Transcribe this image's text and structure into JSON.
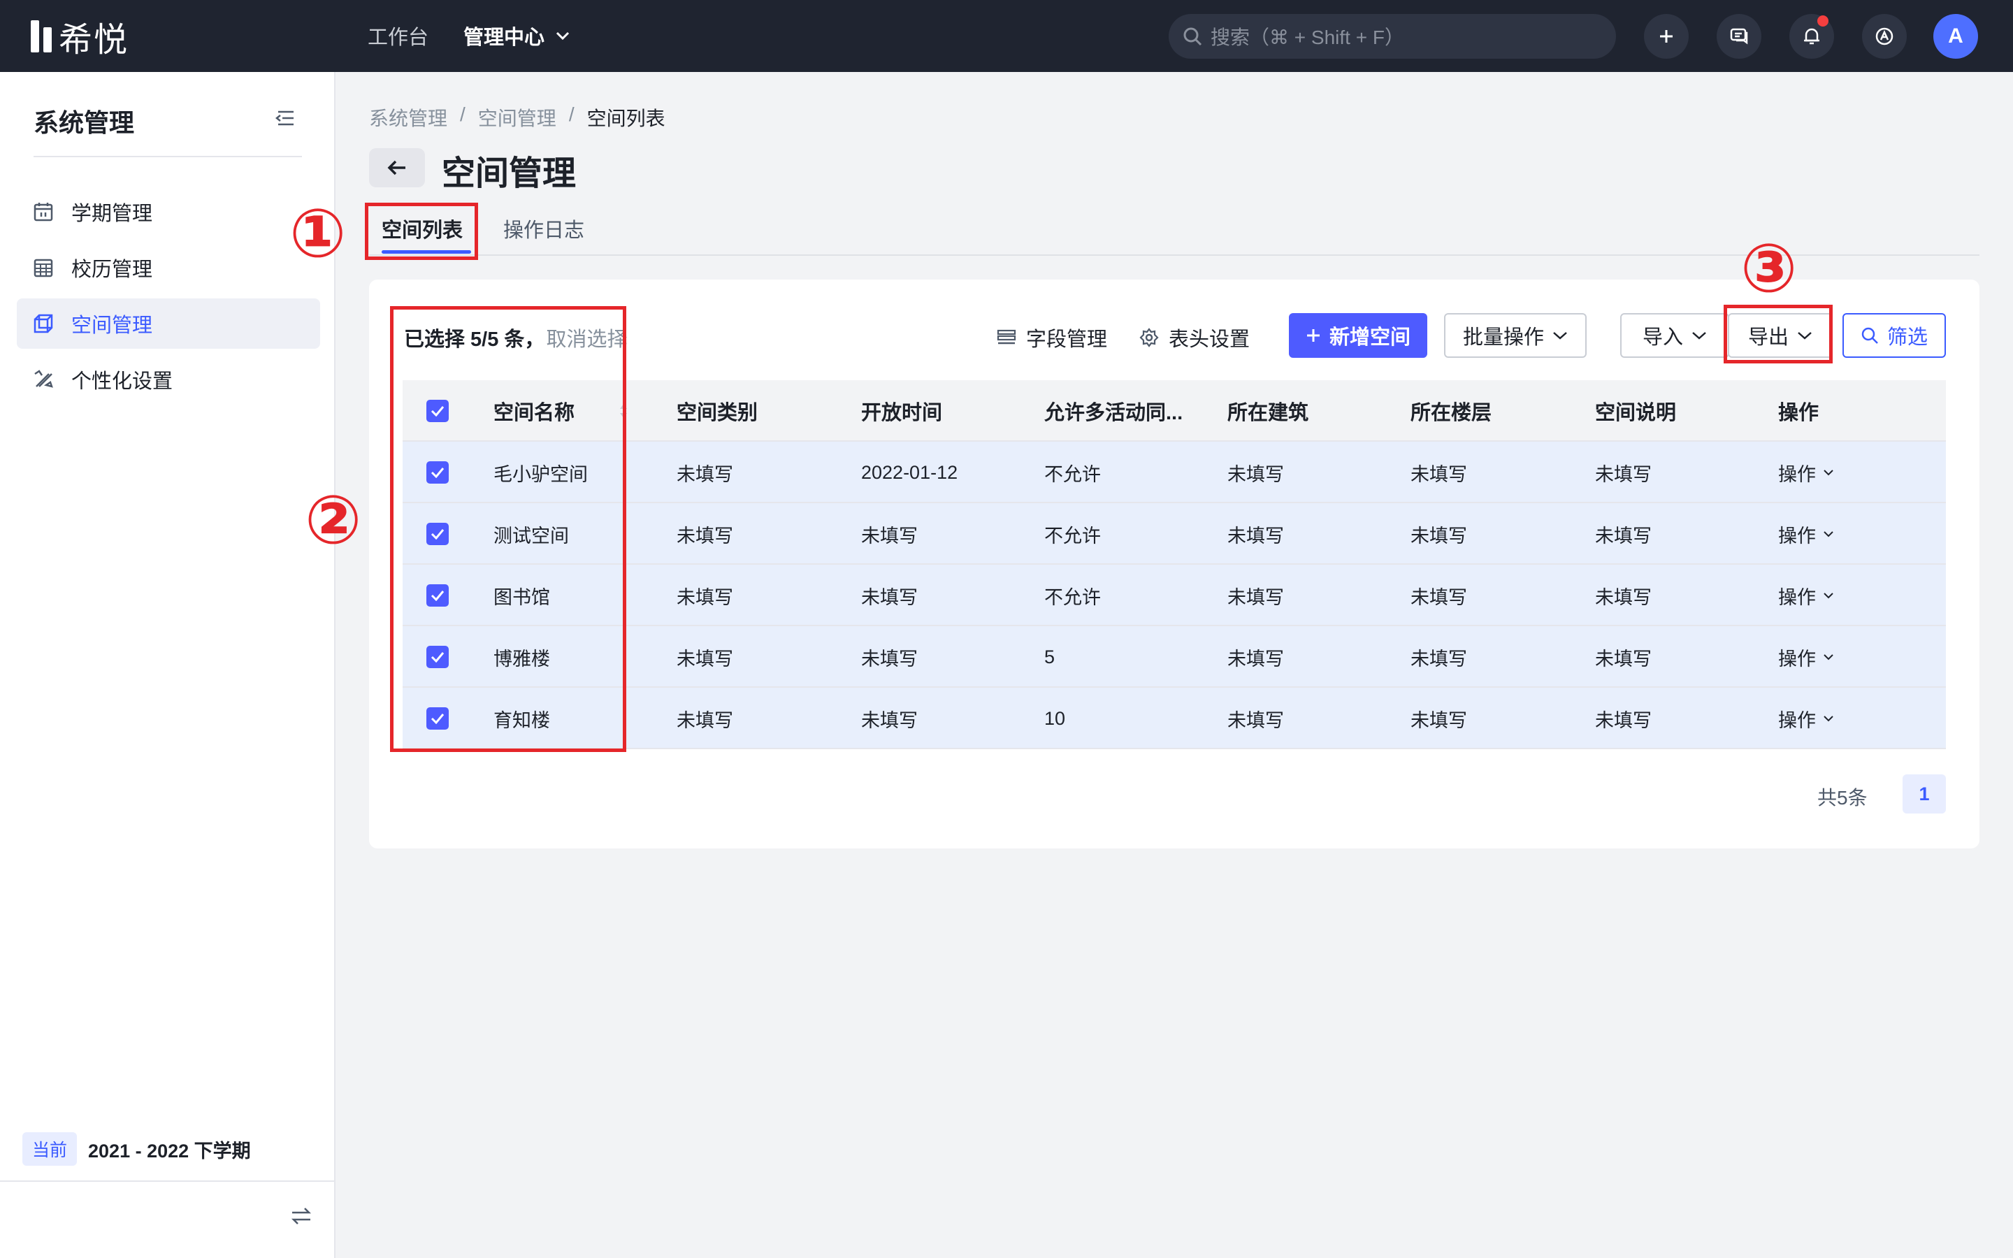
{
  "app": {
    "brand": "希悦",
    "nav": [
      {
        "label": "工作台"
      },
      {
        "label": "管理中心"
      }
    ],
    "search_placeholder": "搜索（⌘ + Shift + F）",
    "avatar_initial": "A"
  },
  "sidebar": {
    "title": "系统管理",
    "items": [
      {
        "label": "学期管理",
        "icon": "calendar-icon"
      },
      {
        "label": "校历管理",
        "icon": "calendar-grid-icon"
      },
      {
        "label": "空间管理",
        "icon": "cube-icon",
        "active": true
      },
      {
        "label": "个性化设置",
        "icon": "brush-icon"
      }
    ],
    "term_tag": "当前",
    "term_label": "2021 - 2022 下学期"
  },
  "breadcrumb": [
    "系统管理",
    "空间管理",
    "空间列表"
  ],
  "page_title": "空间管理",
  "tabs": [
    {
      "label": "空间列表",
      "active": true
    },
    {
      "label": "操作日志"
    }
  ],
  "toolbar": {
    "selection_text": "已选择 5/5 条，",
    "cancel_selection": "取消选择",
    "field_manage": "字段管理",
    "header_settings": "表头设置",
    "add_space": "新增空间",
    "batch_ops": "批量操作",
    "import": "导入",
    "export": "导出",
    "filter": "筛选"
  },
  "table": {
    "columns": [
      "空间名称",
      "空间类别",
      "开放时间",
      "允许多活动同...",
      "所在建筑",
      "所在楼层",
      "空间说明",
      "操作"
    ],
    "rows": [
      {
        "cells": [
          "毛小驴空间",
          "未填写",
          "2022-01-12",
          "不允许",
          "未填写",
          "未填写",
          "未填写"
        ],
        "action": "操作"
      },
      {
        "cells": [
          "测试空间",
          "未填写",
          "未填写",
          "不允许",
          "未填写",
          "未填写",
          "未填写"
        ],
        "action": "操作"
      },
      {
        "cells": [
          "图书馆",
          "未填写",
          "未填写",
          "不允许",
          "未填写",
          "未填写",
          "未填写"
        ],
        "action": "操作"
      },
      {
        "cells": [
          "博雅楼",
          "未填写",
          "未填写",
          "5",
          "未填写",
          "未填写",
          "未填写"
        ],
        "action": "操作"
      },
      {
        "cells": [
          "育知楼",
          "未填写",
          "未填写",
          "10",
          "未填写",
          "未填写",
          "未填写"
        ],
        "action": "操作"
      }
    ]
  },
  "pagination": {
    "total": "共5条",
    "current_page": "1"
  },
  "annotations": [
    "①",
    "②",
    "③"
  ],
  "colors": {
    "topbar": "#1f2430",
    "accent": "#4e5bff",
    "annotation": "#e5262a",
    "row_selected": "#e8effc"
  }
}
